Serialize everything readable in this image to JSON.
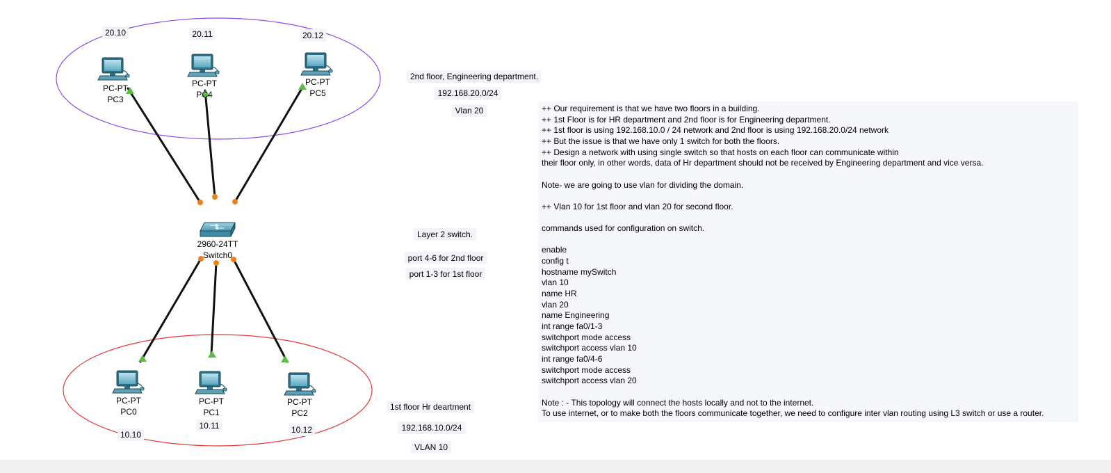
{
  "devices": {
    "pc0": {
      "type": "PC-PT",
      "name": "PC0",
      "icon": "pc-icon"
    },
    "pc1": {
      "type": "PC-PT",
      "name": "PC1",
      "icon": "pc-icon"
    },
    "pc2": {
      "type": "PC-PT",
      "name": "PC2",
      "icon": "pc-icon"
    },
    "pc3": {
      "type": "PC-PT",
      "name": "PC3",
      "icon": "pc-icon"
    },
    "pc4": {
      "type": "PC-PT",
      "name": "PC4",
      "icon": "pc-icon"
    },
    "pc5": {
      "type": "PC-PT",
      "name": "PC5",
      "icon": "pc-icon"
    },
    "switch0": {
      "type": "2960-24TT",
      "name": "Switch0",
      "icon": "switch-icon"
    }
  },
  "addresses": {
    "pc0": "10.10",
    "pc1": "10.11",
    "pc2": "10.12",
    "pc3": "20.10",
    "pc4": "20.11",
    "pc5": "20.12"
  },
  "notes": {
    "floor2_title": "2nd floor, Engineering department.",
    "floor2_network": "192.168.20.0/24",
    "floor2_vlan": "Vlan 20",
    "switch_type": "Layer 2 switch.",
    "ports_floor2": "port 4-6 for 2nd floor",
    "ports_floor1": "port 1-3 for 1st floor",
    "floor1_title": "1st floor Hr deartment",
    "floor1_network": "192.168.10.0/24",
    "floor1_vlan": "VLAN 10"
  },
  "description_lines": [
    "++ Our requirement is that we have two floors in a building.",
    "++ 1st Floor is for HR department and 2nd floor is for Engineering department.",
    "++ 1st floor is using 192.168.10.0 / 24 network and 2nd floor is using 192.168.20.0/24 network",
    "++ But the issue is that we have only 1 switch for both the floors.",
    "++ Design a network with using single switch so that hosts on each floor can communicate within",
    "their floor only, in other words, data of Hr department should not be received by Engineering department and vice versa.",
    "",
    "Note- we are going to use vlan for dividing the domain.",
    "",
    "++ Vlan 10 for 1st floor and vlan 20 for second floor.",
    "",
    "commands used for configuration on switch.",
    "",
    "enable",
    "config t",
    "hostname mySwitch",
    "vlan 10",
    "name HR",
    "vlan 20",
    "name Engineering",
    "int range fa0/1-3",
    "switchport mode access",
    "switchport access vlan 10",
    "int range fa0/4-6",
    "switchport mode access",
    "switchport access vlan 20",
    "",
    "Note : - This topology will connect the hosts locally and not to the internet.",
    "To use internet, or to make both the floors communicate together, we need to configure inter vlan routing using L3 switch or use a router."
  ],
  "colors": {
    "floor2_ellipse": "#8a4bf0",
    "floor1_ellipse": "#e53935",
    "link": "#111111",
    "link_up": "#5bbd45",
    "link_switch_port": "#f07f1e",
    "device": "#3f8fa8",
    "note_background": "#f3f4f9"
  }
}
